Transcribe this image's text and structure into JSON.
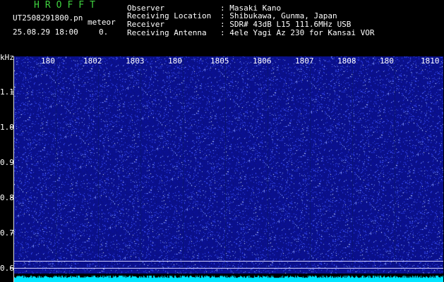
{
  "header": {
    "brand": "HROFFT",
    "filename": "UT2508291800.pn",
    "mode": "meteor",
    "datetime": "25.08.29 18:00",
    "count": "0.",
    "info": [
      {
        "label": "Observer",
        "value": ": Masaki Kano"
      },
      {
        "label": "Receiving Location",
        "value": ": Shibukawa, Gunma, Japan"
      },
      {
        "label": "Receiver",
        "value": ": SDR# 43dB L15 111.6MHz USB"
      },
      {
        "label": "Receiving Antenna",
        "value": ": 4ele Yagi Az 230 for Kansai VOR"
      }
    ]
  },
  "plot": {
    "y_unit": "kHz",
    "y_ticks": [
      "1.1",
      "1.0",
      "0.9",
      "0.8",
      "0.7",
      "0.6"
    ],
    "time_labels": [
      "180",
      "1802",
      "1803",
      "180",
      "1805",
      "1806",
      "1807",
      "1808",
      "180",
      "1810"
    ],
    "colors": {
      "background": "#0b1290",
      "noise": "#4a5cff",
      "spectrum": "#00e5ff",
      "brand": "#3fd23f"
    }
  }
}
